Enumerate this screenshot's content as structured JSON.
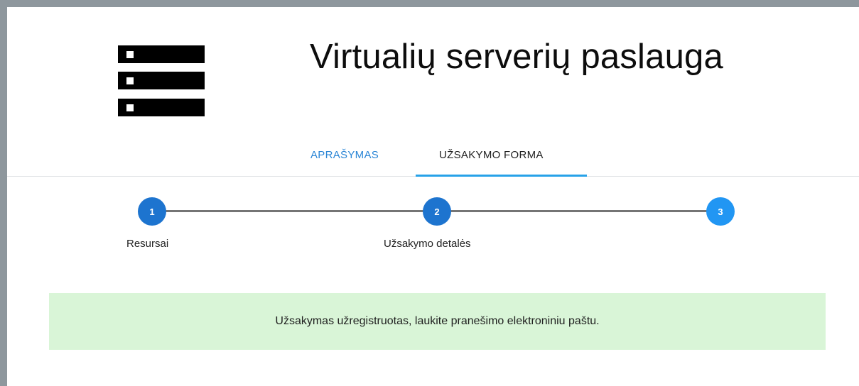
{
  "header": {
    "title": "Virtualių serverių paslauga",
    "icon": "server-icon"
  },
  "tabs": [
    {
      "label": "APRAŠYMAS",
      "active": false
    },
    {
      "label": "UŽSAKYMO FORMA",
      "active": true
    }
  ],
  "stepper": {
    "steps": [
      {
        "number": "1",
        "label": "Resursai"
      },
      {
        "number": "2",
        "label": "Užsakymo detalės"
      },
      {
        "number": "3",
        "label": ""
      }
    ],
    "current_step": 3
  },
  "alert": {
    "message": "Užsakymas užregistruotas, laukite pranešimo elektroniniu paštu."
  },
  "colors": {
    "accent": "#27a2e8",
    "link": "#2b86d6",
    "step_done": "#1d74cf",
    "step_current": "#2196f3",
    "success_bg": "#d9f5d7",
    "frame": "#8e979d"
  }
}
